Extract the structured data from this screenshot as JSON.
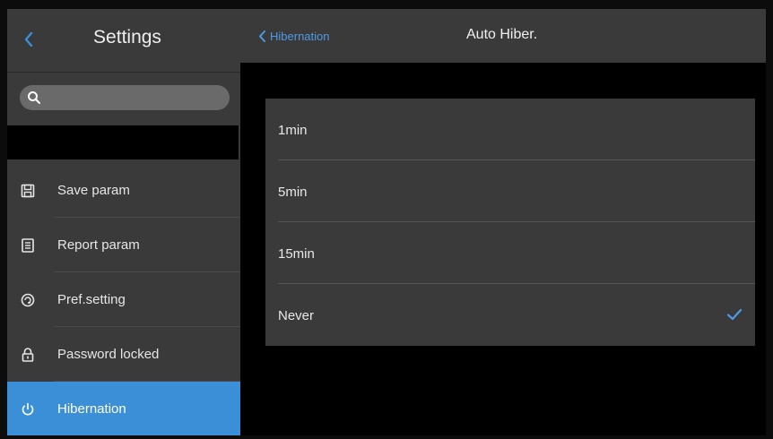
{
  "colors": {
    "accent": "#3b8fd6",
    "link": "#4d9ae6",
    "panel": "#3a3a3a",
    "background": "#000000"
  },
  "sidebar": {
    "title": "Settings",
    "back_icon": "chevron-left-icon",
    "search": {
      "icon": "search-icon",
      "placeholder": "",
      "value": ""
    },
    "items": [
      {
        "label": "Save param",
        "icon": "save-icon",
        "active": false
      },
      {
        "label": "Report param",
        "icon": "report-icon",
        "active": false
      },
      {
        "label": "Pref.setting",
        "icon": "preference-icon",
        "active": false
      },
      {
        "label": "Password locked",
        "icon": "lock-icon",
        "active": false
      },
      {
        "label": "Hibernation",
        "icon": "power-icon",
        "active": true
      }
    ]
  },
  "header": {
    "back_label": "Hibernation",
    "title": "Auto Hiber."
  },
  "options": [
    {
      "label": "1min",
      "selected": false
    },
    {
      "label": "5min",
      "selected": false
    },
    {
      "label": "15min",
      "selected": false
    },
    {
      "label": "Never",
      "selected": true
    }
  ]
}
